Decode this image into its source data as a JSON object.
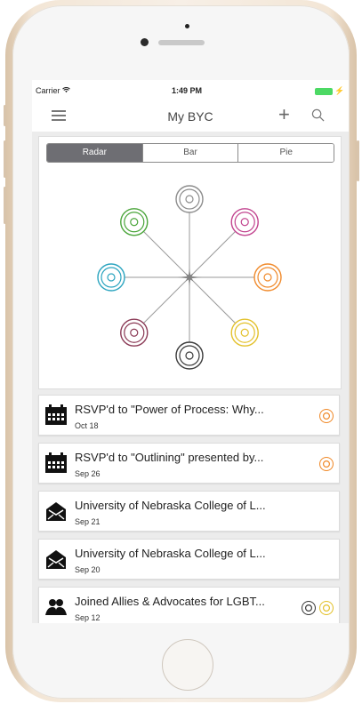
{
  "status_bar": {
    "carrier": "Carrier",
    "time": "1:49 PM",
    "battery_color": "#4cd964"
  },
  "nav": {
    "title": "My BYC",
    "left_icon": "menu-icon",
    "add_icon": "plus-icon",
    "search_icon": "search-icon"
  },
  "tabs": [
    {
      "label": "Radar",
      "selected": true
    },
    {
      "label": "Bar",
      "selected": false
    },
    {
      "label": "Pie",
      "selected": false
    }
  ],
  "radar": {
    "nodes": [
      {
        "name": "gear-head-icon",
        "color": "#8c8c8c"
      },
      {
        "name": "scales-icon",
        "color": "#c2448f"
      },
      {
        "name": "document-icon",
        "color": "#f08a2b"
      },
      {
        "name": "people-group-icon",
        "color": "#e3c12b"
      },
      {
        "name": "chat-bubbles-icon",
        "color": "#3a3a3a"
      },
      {
        "name": "venn-circles-icon",
        "color": "#8b3a56"
      },
      {
        "name": "magnify-chart-icon",
        "color": "#2aa4bf"
      },
      {
        "name": "recycle-icon",
        "color": "#4aa53a"
      }
    ]
  },
  "feed": [
    {
      "icon": "calendar-icon",
      "title": "RSVP'd to \"Power of Process: Why...",
      "date": "Oct 18",
      "badges": [
        "#f08a2b"
      ]
    },
    {
      "icon": "calendar-icon",
      "title": "RSVP'd to \"Outlining\" presented by...",
      "date": "Sep 26",
      "badges": [
        "#f08a2b"
      ]
    },
    {
      "icon": "envelope-icon",
      "title": "University of Nebraska College of L...",
      "date": "Sep 21",
      "badges": []
    },
    {
      "icon": "envelope-icon",
      "title": "University of Nebraska College of L...",
      "date": "Sep 20",
      "badges": []
    },
    {
      "icon": "group-icon",
      "title": "Joined Allies & Advocates for LGBT...",
      "date": "Sep 12",
      "badges": [
        "#3a3a3a",
        "#e3c12b"
      ]
    }
  ]
}
